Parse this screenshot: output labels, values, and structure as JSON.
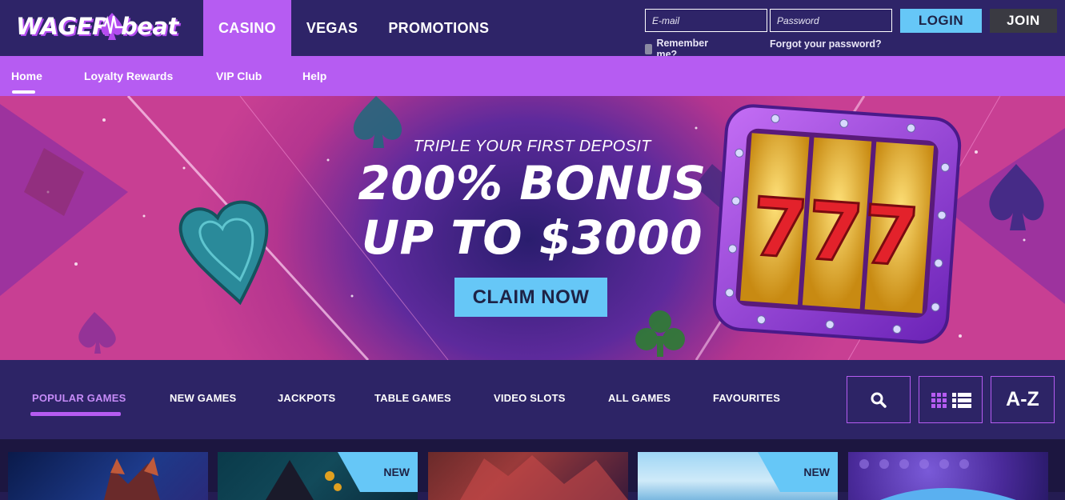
{
  "brand": {
    "logo_left": "WAGER",
    "logo_right": "beat",
    "accent": "#b65cf2",
    "button_blue": "#66c7f7"
  },
  "main_nav": [
    {
      "label": "CASINO",
      "active": true
    },
    {
      "label": "VEGAS",
      "active": false
    },
    {
      "label": "PROMOTIONS",
      "active": false
    }
  ],
  "login": {
    "email_placeholder": "E-mail",
    "password_placeholder": "Password",
    "remember_label": "Remember me?",
    "forgot_label": "Forgot your password?",
    "login_label": "LOGIN",
    "join_label": "JOIN"
  },
  "sub_nav": [
    {
      "label": "Home",
      "active": true
    },
    {
      "label": "Loyalty Rewards",
      "active": false
    },
    {
      "label": "VIP Club",
      "active": false
    },
    {
      "label": "Help",
      "active": false
    }
  ],
  "hero": {
    "subtitle": "TRIPLE YOUR FIRST DEPOSIT",
    "title_line1": "200% BONUS",
    "title_line2": "UP TO $3000",
    "cta_label": "CLAIM NOW",
    "slot_symbol": "777"
  },
  "categories": [
    {
      "label": "POPULAR GAMES",
      "active": true
    },
    {
      "label": "NEW GAMES",
      "active": false
    },
    {
      "label": "JACKPOTS",
      "active": false
    },
    {
      "label": "TABLE GAMES",
      "active": false
    },
    {
      "label": "VIDEO SLOTS",
      "active": false
    },
    {
      "label": "ALL GAMES",
      "active": false
    },
    {
      "label": "FAVOURITES",
      "active": false
    }
  ],
  "tools": {
    "search_icon": "search-icon",
    "view_icon": "grid-list-icon",
    "az_label": "A-Z"
  },
  "tiles": [
    {
      "badge": ""
    },
    {
      "badge": "NEW"
    },
    {
      "badge": ""
    },
    {
      "badge": "NEW"
    },
    {
      "badge": ""
    }
  ]
}
